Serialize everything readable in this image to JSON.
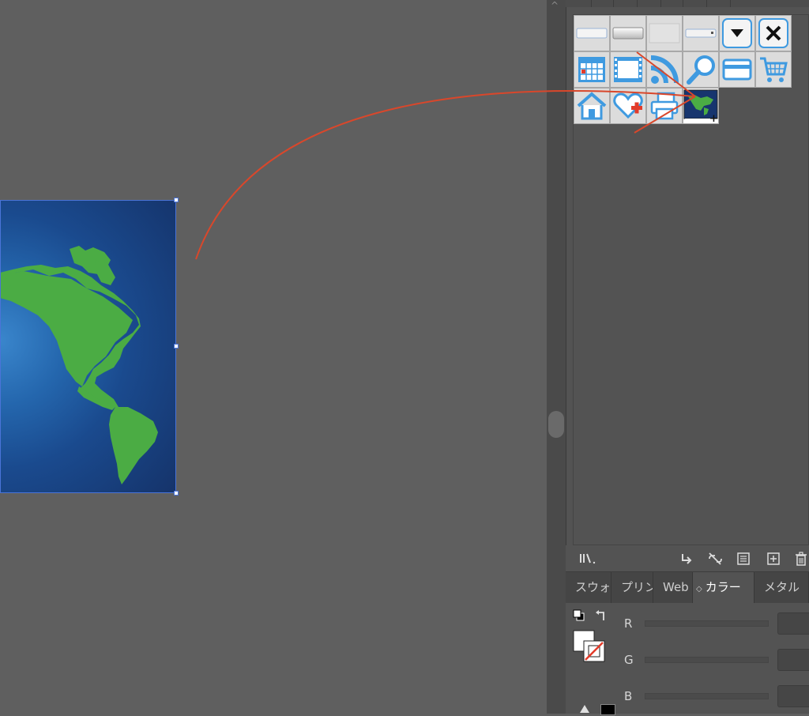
{
  "canvas": {
    "artwork_name": "world-map-artwork",
    "ocean_color": "#1a4a8e",
    "land_color": "#4bac44"
  },
  "symbols_panel": {
    "symbols": [
      {
        "name": "button-flat-symbol"
      },
      {
        "name": "button-glossy-symbol"
      },
      {
        "name": "button-blank-symbol"
      },
      {
        "name": "dropdown-field-symbol"
      },
      {
        "name": "dropdown-arrow-symbol"
      },
      {
        "name": "close-x-symbol"
      },
      {
        "name": "calendar-symbol"
      },
      {
        "name": "film-strip-symbol"
      },
      {
        "name": "rss-feed-symbol"
      },
      {
        "name": "magnifier-symbol"
      },
      {
        "name": "credit-card-symbol"
      },
      {
        "name": "shopping-cart-symbol"
      },
      {
        "name": "home-symbol"
      },
      {
        "name": "heart-plus-symbol"
      },
      {
        "name": "printer-symbol"
      },
      {
        "name": "world-map-symbol"
      }
    ],
    "drag_plus": "+",
    "footer_icons": [
      "symbol-libraries-icon",
      "place-symbol-instance-icon",
      "break-link-icon",
      "symbol-options-icon",
      "new-symbol-icon",
      "delete-symbol-icon"
    ]
  },
  "tabs": [
    {
      "label": "スウォ"
    },
    {
      "label": "プリン"
    },
    {
      "label": "Web"
    },
    {
      "label": "カラー"
    },
    {
      "label": "メタル"
    }
  ],
  "tab_toggle_glyph": "◇",
  "color_panel": {
    "channels": [
      {
        "label": "R"
      },
      {
        "label": "G"
      },
      {
        "label": "B"
      }
    ]
  },
  "accent": {
    "selection": "#4a74d8",
    "annotation_arrow": "#d9472b",
    "icon_blue": "#3f9ae0"
  }
}
